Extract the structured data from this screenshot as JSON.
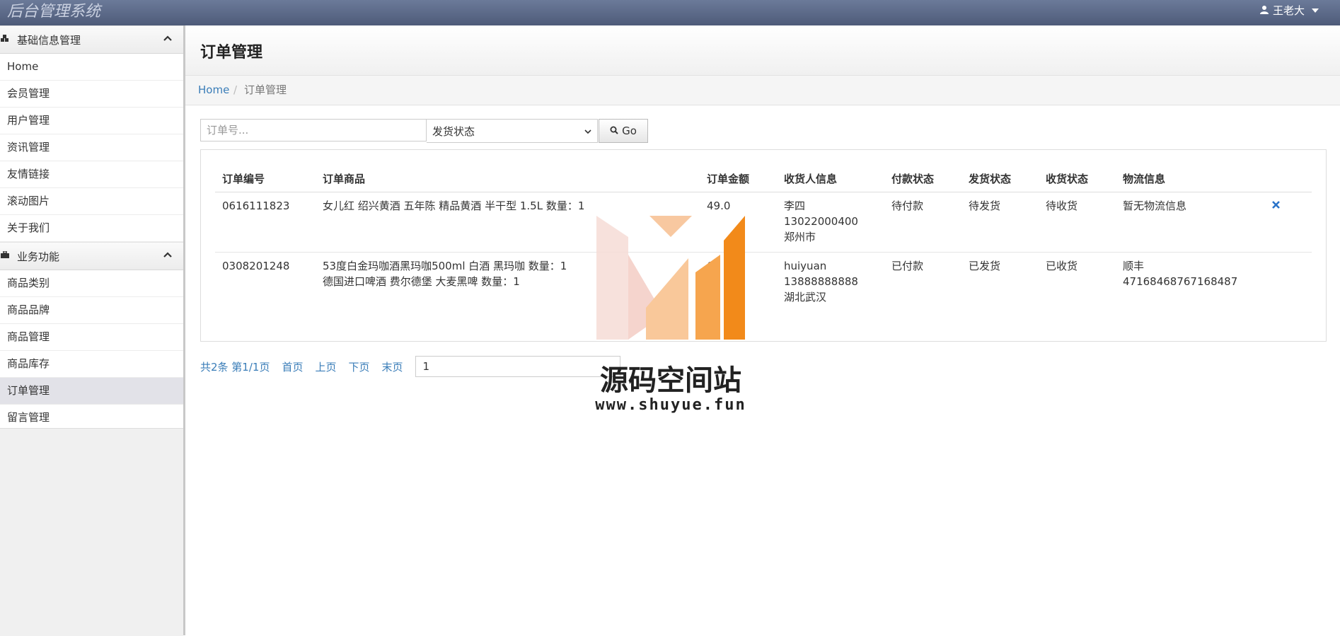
{
  "app": {
    "brand": "后台管理系统",
    "user": "王老大"
  },
  "sidebar": {
    "sections": [
      {
        "title": "基础信息管理",
        "icon": "cubes-icon",
        "items": [
          "Home",
          "会员管理",
          "用户管理",
          "资讯管理",
          "友情链接",
          "滚动图片",
          "关于我们"
        ]
      },
      {
        "title": "业务功能",
        "icon": "briefcase-icon",
        "items": [
          "商品类别",
          "商品品牌",
          "商品管理",
          "商品库存",
          "订单管理",
          "留言管理"
        ]
      }
    ],
    "active": "订单管理"
  },
  "page": {
    "title": "订单管理"
  },
  "breadcrumb": {
    "home": "Home",
    "sep": "/",
    "current": "订单管理"
  },
  "search": {
    "placeholder": "订单号...",
    "status_value": "发货状态",
    "go_label": "Go"
  },
  "table": {
    "headers": [
      "订单编号",
      "订单商品",
      "订单金额",
      "收货人信息",
      "付款状态",
      "发货状态",
      "收货状态",
      "物流信息"
    ],
    "rows": [
      {
        "order_no": "0616111823",
        "goods": [
          "女儿红 绍兴黄酒 五年陈 精品黄酒 半干型 1.5L   数量：1"
        ],
        "amount": "49.0",
        "receiver": [
          "李四",
          "13022000400",
          "郑州市"
        ],
        "pay": "待付款",
        "ship": "待发货",
        "receive": "待收货",
        "logistics": [
          "暂无物流信息"
        ],
        "delete_icon": "close-icon"
      },
      {
        "order_no": "0308201248",
        "goods": [
          "53度白金玛咖酒黑玛咖500ml 白酒 黑玛咖   数量：1",
          "德国进口啤酒 费尔德堡 大麦黑啤   数量：1"
        ],
        "amount": "69",
        "receiver": [
          "huiyuan",
          "13888888888",
          "湖北武汉"
        ],
        "pay": "已付款",
        "ship": "已发货",
        "receive": "已收货",
        "logistics": [
          "顺丰",
          "47168468767168487"
        ]
      }
    ]
  },
  "pager": {
    "summary": "共2条 第1/1页",
    "first": "首页",
    "prev": "上页",
    "next": "下页",
    "last": "末页",
    "page_value": "1"
  },
  "watermark": {
    "title": "源码空间站",
    "url": "www.shuyue.fun"
  },
  "colors": {
    "navbar": "#56627f",
    "link": "#3a7db8",
    "accent_orange": "#f28a1a"
  }
}
